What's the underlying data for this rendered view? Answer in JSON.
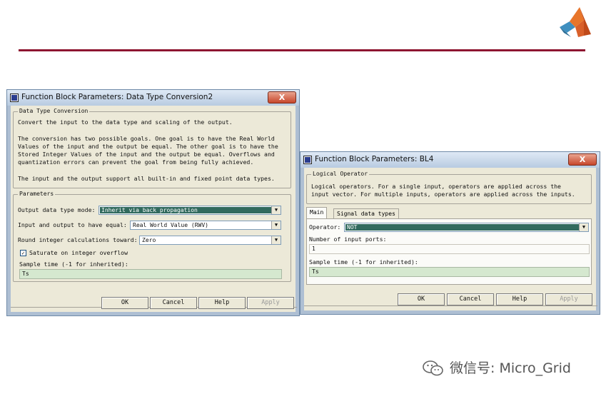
{
  "dialog1": {
    "title": "Function Block Parameters: Data Type  Conversion2",
    "close_label": "X",
    "desc_group_label": "Data Type Conversion",
    "desc_lines": [
      "Convert the input to the data type and scaling of the output.",
      "",
      "The conversion has two possible goals. One goal is to have the Real World",
      "Values of the input and the output be equal.  The other goal is to have the",
      "Stored Integer Values of the input and the output be equal.  Overflows and",
      "quantization errors can prevent the goal from being fully achieved.",
      "",
      "The input and the output support all built-in and fixed point data types."
    ],
    "params_group_label": "Parameters",
    "output_type_label": "Output data type mode:",
    "output_type_value": "Inherit via back propagation",
    "equal_label": "Input and output to have equal:",
    "equal_value": "Real World Value (RWV)",
    "round_label": "Round integer calculations toward:",
    "round_value": "Zero",
    "saturate_label": "Saturate on integer overflow",
    "saturate_checked": true,
    "sample_label": "Sample time (-1 for inherited):",
    "sample_value": "Ts",
    "buttons": {
      "ok": "OK",
      "cancel": "Cancel",
      "help": "Help",
      "apply": "Apply"
    }
  },
  "dialog2": {
    "title": "Function Block Parameters: BL4",
    "close_label": "X",
    "desc_group_label": "Logical Operator",
    "desc_lines": [
      "Logical operators.  For a single input, operators are applied across the",
      "input vector.  For multiple inputs, operators are applied across the inputs."
    ],
    "tabs": [
      "Main",
      "Signal data types"
    ],
    "operator_label": "Operator:",
    "operator_value": "NOT",
    "ports_label": "Number of input ports:",
    "ports_value": "1",
    "sample_label": "Sample time (-1 for inherited):",
    "sample_value": "Ts",
    "buttons": {
      "ok": "OK",
      "cancel": "Cancel",
      "help": "Help",
      "apply": "Apply"
    }
  },
  "watermark": {
    "text": "微信号: Micro_Grid",
    "icon": "wechat-icon"
  },
  "logo": {
    "icon": "matlab-logo"
  },
  "colors": {
    "accent_rule": "#8e1530",
    "selection": "#316a5e",
    "field_bg": "#d5e8cf"
  }
}
